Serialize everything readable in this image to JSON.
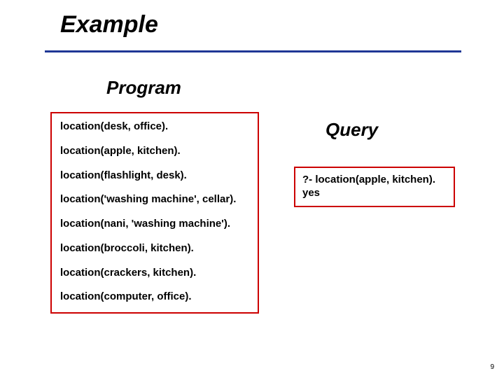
{
  "slide": {
    "title": "Example",
    "page_number": "9"
  },
  "program": {
    "heading": "Program",
    "lines": [
      "location(desk, office).",
      "location(apple, kitchen).",
      "location(flashlight, desk).",
      "location('washing machine', cellar).",
      "location(nani, 'washing machine').",
      "location(broccoli, kitchen).",
      "location(crackers, kitchen).",
      "location(computer, office)."
    ]
  },
  "query": {
    "heading": "Query",
    "prompt": "?- location(apple, kitchen).",
    "result": "yes"
  }
}
